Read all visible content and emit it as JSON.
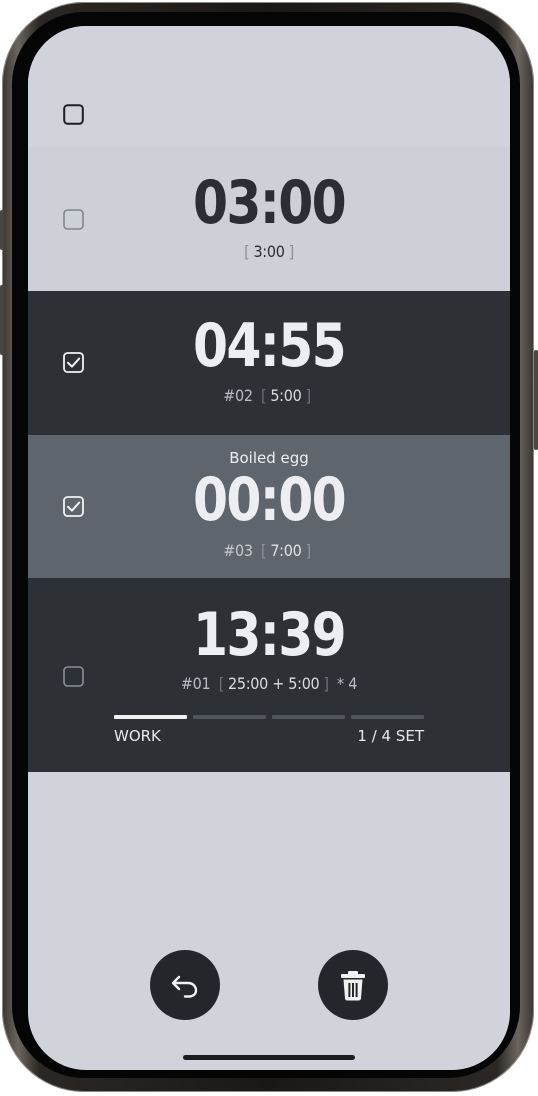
{
  "timers": [
    {
      "checked": false,
      "label": "",
      "time": "03:00",
      "index": "",
      "duration": "3:00",
      "repeat": ""
    },
    {
      "checked": true,
      "label": "",
      "time": "04:55",
      "index": "#02",
      "duration": "5:00",
      "repeat": ""
    },
    {
      "checked": true,
      "label": "Boiled egg",
      "time": "00:00",
      "index": "#03",
      "duration": "7:00",
      "repeat": ""
    },
    {
      "checked": false,
      "label": "",
      "time": "13:39",
      "index": "#01",
      "duration": "25:00 + 5:00",
      "repeat": "* 4",
      "phase": "WORK",
      "set_progress": "1 / 4 SET",
      "sets_completed_fraction": 0.25
    }
  ],
  "brackets": {
    "open": "[",
    "close": "]"
  },
  "icons": {
    "select_all": "checkbox-icon",
    "undo": "undo-icon",
    "delete": "trash-icon"
  },
  "colors": {
    "background": "#d0d4da",
    "row_dark": "#2d3035",
    "row_mid": "#5f656d",
    "button": "#23262a"
  }
}
